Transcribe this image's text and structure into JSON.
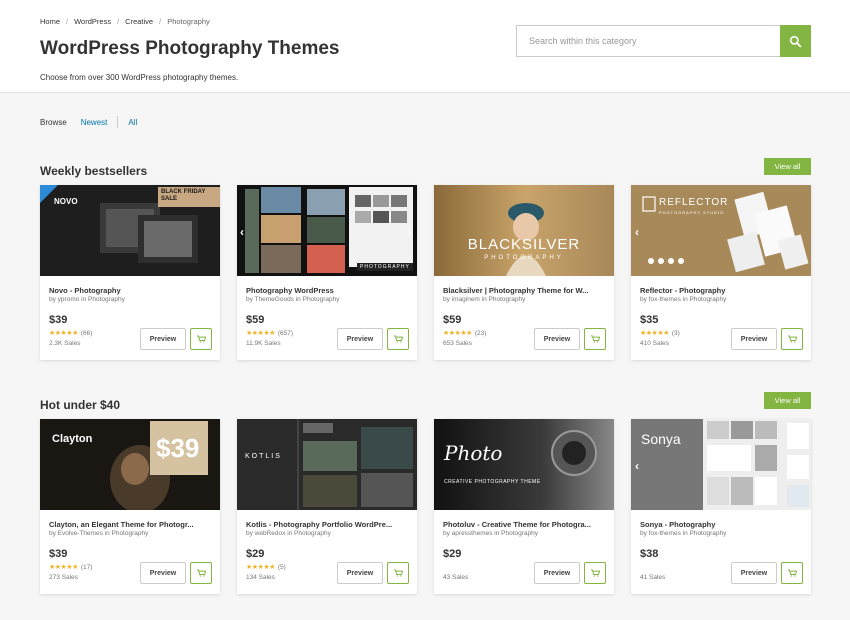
{
  "breadcrumb": [
    "Home",
    "WordPress",
    "Creative",
    "Photography"
  ],
  "page_title": "WordPress Photography Themes",
  "page_subtitle": "Choose from over 300 WordPress photography themes.",
  "search": {
    "placeholder": "Search within this category"
  },
  "browse": {
    "label": "Browse",
    "options": [
      "Newest",
      "All"
    ]
  },
  "colors": {
    "accent": "#82b541",
    "link": "#0073aa",
    "star": "#f0b428"
  },
  "sections": [
    {
      "title": "Weekly bestsellers",
      "view_all": "View all",
      "cards": [
        {
          "title": "Novo - Photography",
          "author": "by ypromo in Photography",
          "price": "$39",
          "stars": "★★★★★",
          "rating_count": "(66)",
          "sales": "2.3K Sales",
          "preview": "Preview",
          "thumb_text": "NOVO",
          "badge": "BLACK FRIDAY SALE"
        },
        {
          "title": "Photography WordPress",
          "author": "by ThemeGoods in Photography",
          "price": "$59",
          "stars": "★★★★★",
          "rating_count": "(657)",
          "sales": "11.9K Sales",
          "preview": "Preview",
          "thumb_text": "PHOTOGRAPHY"
        },
        {
          "title": "Blacksilver | Photography Theme for W...",
          "author": "by imaginem in Photography",
          "price": "$59",
          "stars": "★★★★★",
          "rating_count": "(23)",
          "sales": "653 Sales",
          "preview": "Preview",
          "thumb_text": "BLACKSILVER",
          "thumb_sub": "PHOTOGRAPHY"
        },
        {
          "title": "Reflector - Photography",
          "author": "by fox-themes in Photography",
          "price": "$35",
          "stars": "★★★★★",
          "rating_count": "(3)",
          "sales": "410 Sales",
          "preview": "Preview",
          "thumb_text": "REFLECTOR",
          "thumb_sub": "PHOTOGRAPHY STUDIO"
        }
      ]
    },
    {
      "title": "Hot under $40",
      "view_all": "View all",
      "cards": [
        {
          "title": "Clayton, an Elegant Theme for Photogr...",
          "author": "by Evolve-Themes in Photography",
          "price": "$39",
          "stars": "★★★★★",
          "rating_count": "(17)",
          "sales": "273 Sales",
          "preview": "Preview",
          "thumb_text": "Clayton",
          "badge": "$39"
        },
        {
          "title": "Kotlis - Photography Portfolio WordPre...",
          "author": "by webRedox in Photography",
          "price": "$29",
          "stars": "★★★★★",
          "rating_count": "(5)",
          "sales": "134 Sales",
          "preview": "Preview",
          "thumb_text": "KOTLIS"
        },
        {
          "title": "Photoluv - Creative Theme for Photogra...",
          "author": "by apressthemes in Photography",
          "price": "$29",
          "stars": "",
          "rating_count": "",
          "sales": "43 Sales",
          "preview": "Preview",
          "thumb_text": "Photo",
          "thumb_sub": "CREATIVE PHOTOGRAPHY THEME"
        },
        {
          "title": "Sonya - Photography",
          "author": "by fox-themes in Photography",
          "price": "$38",
          "stars": "",
          "rating_count": "",
          "sales": "41 Sales",
          "preview": "Preview",
          "thumb_text": "Sonya"
        }
      ]
    }
  ]
}
